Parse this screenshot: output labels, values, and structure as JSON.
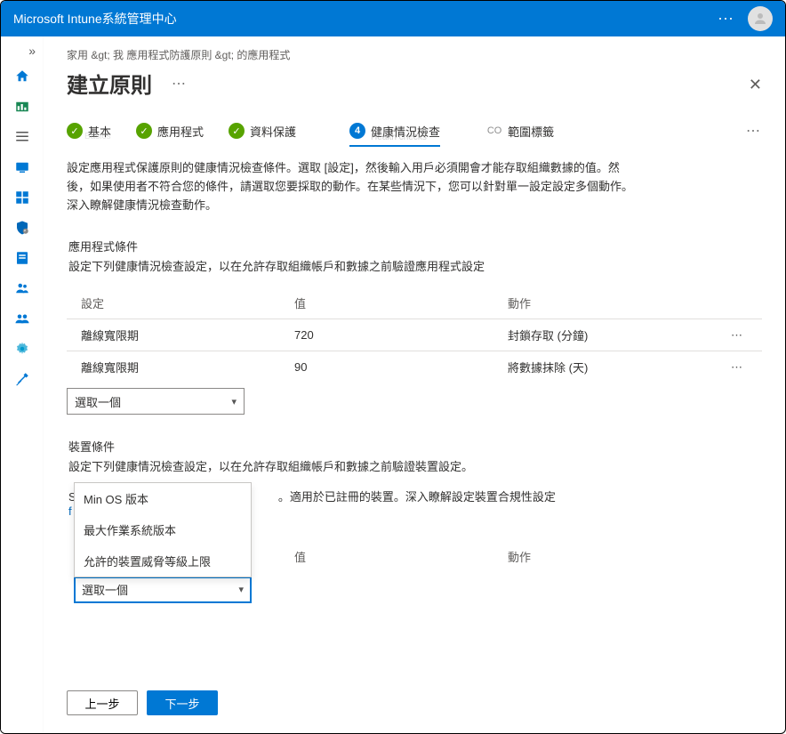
{
  "header": {
    "product": "Microsoft Intune系統管理中心"
  },
  "breadcrumb": "家用 &gt;   我 應用程式防護原則 &gt; 的應用程式",
  "page_title": "建立原則",
  "steps": {
    "s1": "基本",
    "s1_sub": "Basics",
    "s2": "應用程式",
    "s3": "資料保護",
    "s4_num": "4",
    "s4": "健康情況檢查",
    "s4_sub": "Health checks",
    "s5_co": "CO",
    "s5": "範圍標籤"
  },
  "description": "設定應用程式保護原則的健康情況檢查條件。選取 [設定]，然後輸入用戶必須開會才能存取組織數據的值。然後，如果使用者不符合您的條件，請選取您要採取的動作。在某些情況下，您可以針對單一設定設定多個動作。深入瞭解健康情況檢查動作。",
  "app_section": {
    "title": "應用程式條件",
    "subtitle": "設定下列健康情況檢查設定，以在允許存取組織帳戶和數據之前驗證應用程式設定",
    "col_setting": "設定",
    "col_value": "值",
    "col_action": "動作",
    "rows": [
      {
        "setting": "離線寬限期",
        "value": "720",
        "action": "封鎖存取 (分鐘)"
      },
      {
        "setting": "離線寬限期",
        "value": "90",
        "action": "將數據抹除 (天)"
      }
    ],
    "select_placeholder": "選取一個"
  },
  "device_section": {
    "title": "裝置條件",
    "subtitle": "設定下列健康情況檢查設定，以在允許存取組織帳戶和數據之前驗證裝置設定。",
    "line2_a": "S",
    "line2_b": "。適用於已註冊的裝置。深入瞭解設定裝置合規性設定",
    "link": "f",
    "col_value": "值",
    "col_action": "動作",
    "options": [
      "Min OS 版本",
      "最大作業系統版本",
      "允許的裝置威脅等級上限"
    ],
    "select_placeholder": "選取一個"
  },
  "footer": {
    "back": "上一步",
    "next": "下一步"
  }
}
